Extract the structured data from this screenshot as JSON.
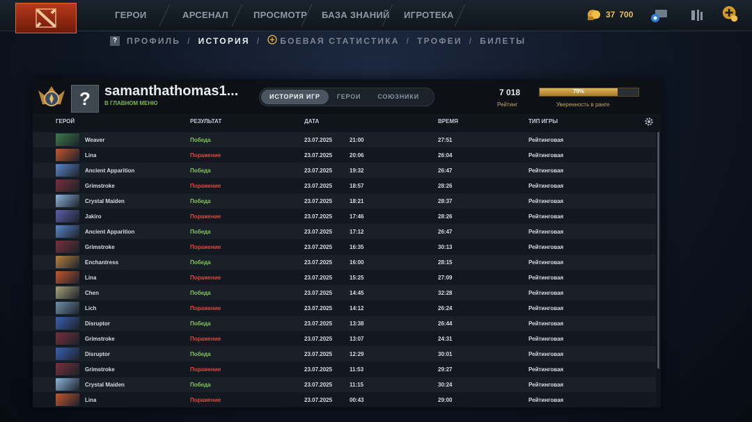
{
  "nav": {
    "items": [
      "ГЕРОИ",
      "АРСЕНАЛ",
      "ПРОСМОТР",
      "БАЗА ЗНАНИЙ",
      "ИГРОТЕКА"
    ],
    "currency_a": "37",
    "currency_b": "700"
  },
  "subnav": {
    "items": [
      "ПРОФИЛЬ",
      "ИСТОРИЯ",
      "БОЕВАЯ СТАТИСТИКА",
      "ТРОФЕИ",
      "БИЛЕТЫ"
    ],
    "active": "ИСТОРИЯ"
  },
  "profile": {
    "username": "samanthathomas1...",
    "status": "В ГЛАВНОМ МЕНЮ",
    "avatar_symbol": "?",
    "tabs": [
      "ИСТОРИЯ ИГР",
      "ГЕРОИ",
      "СОЮЗНИКИ"
    ],
    "rating_value": "7 018",
    "rating_label": "Рейтинг",
    "confidence_percent": 79,
    "confidence_text": "79%",
    "confidence_label": "Уверенность в ранге"
  },
  "table": {
    "columns": [
      "ГЕРОЙ",
      "РЕЗУЛЬТАТ",
      "ДАТА",
      "ВРЕМЯ",
      "ТИП ИГРЫ"
    ],
    "rows": [
      {
        "hero": "Weaver",
        "result": "Победа",
        "win": true,
        "date": "23.07.2025",
        "time": "21:00",
        "duration": "27:51",
        "mode": "Рейтинговая"
      },
      {
        "hero": "Lina",
        "result": "Поражение",
        "win": false,
        "date": "23.07.2025",
        "time": "20:06",
        "duration": "26:04",
        "mode": "Рейтинговая"
      },
      {
        "hero": "Ancient Apparition",
        "result": "Победа",
        "win": true,
        "date": "23.07.2025",
        "time": "19:32",
        "duration": "26:47",
        "mode": "Рейтинговая"
      },
      {
        "hero": "Grimstroke",
        "result": "Поражение",
        "win": false,
        "date": "23.07.2025",
        "time": "18:57",
        "duration": "28:26",
        "mode": "Рейтинговая"
      },
      {
        "hero": "Crystal Maiden",
        "result": "Победа",
        "win": true,
        "date": "23.07.2025",
        "time": "18:21",
        "duration": "28:37",
        "mode": "Рейтинговая"
      },
      {
        "hero": "Jakiro",
        "result": "Поражение",
        "win": false,
        "date": "23.07.2025",
        "time": "17:46",
        "duration": "28:26",
        "mode": "Рейтинговая"
      },
      {
        "hero": "Ancient Apparition",
        "result": "Победа",
        "win": true,
        "date": "23.07.2025",
        "time": "17:12",
        "duration": "26:47",
        "mode": "Рейтинговая"
      },
      {
        "hero": "Grimstroke",
        "result": "Поражение",
        "win": false,
        "date": "23.07.2025",
        "time": "16:35",
        "duration": "30:13",
        "mode": "Рейтинговая"
      },
      {
        "hero": "Enchantress",
        "result": "Победа",
        "win": true,
        "date": "23.07.2025",
        "time": "16:00",
        "duration": "28:15",
        "mode": "Рейтинговая"
      },
      {
        "hero": "Lina",
        "result": "Поражение",
        "win": false,
        "date": "23.07.2025",
        "time": "15:25",
        "duration": "27:09",
        "mode": "Рейтинговая"
      },
      {
        "hero": "Chen",
        "result": "Победа",
        "win": true,
        "date": "23.07.2025",
        "time": "14:45",
        "duration": "32:28",
        "mode": "Рейтинговая"
      },
      {
        "hero": "Lich",
        "result": "Поражение",
        "win": false,
        "date": "23.07.2025",
        "time": "14:12",
        "duration": "26:24",
        "mode": "Рейтинговая"
      },
      {
        "hero": "Disruptor",
        "result": "Победа",
        "win": true,
        "date": "23.07.2025",
        "time": "13:38",
        "duration": "26:44",
        "mode": "Рейтинговая"
      },
      {
        "hero": "Grimstroke",
        "result": "Поражение",
        "win": false,
        "date": "23.07.2025",
        "time": "13:07",
        "duration": "24:31",
        "mode": "Рейтинговая"
      },
      {
        "hero": "Disruptor",
        "result": "Победа",
        "win": true,
        "date": "23.07.2025",
        "time": "12:29",
        "duration": "30:01",
        "mode": "Рейтинговая"
      },
      {
        "hero": "Grimstroke",
        "result": "Поражение",
        "win": false,
        "date": "23.07.2025",
        "time": "11:53",
        "duration": "29:27",
        "mode": "Рейтинговая"
      },
      {
        "hero": "Crystal Maiden",
        "result": "Победа",
        "win": true,
        "date": "23.07.2025",
        "time": "11:15",
        "duration": "30:24",
        "mode": "Рейтинговая"
      },
      {
        "hero": "Lina",
        "result": "Поражение",
        "win": false,
        "date": "23.07.2025",
        "time": "00:43",
        "duration": "29:00",
        "mode": "Рейтинговая"
      }
    ]
  },
  "colors": {
    "win": "#84c45a",
    "loss": "#e0473d",
    "accent_gold": "#e0b25a",
    "hero_thumbs": {
      "Weaver": "#3f7a4a",
      "Lina": "#c4562a",
      "Ancient Apparition": "#5e86c9",
      "Grimstroke": "#7a2f3a",
      "Crystal Maiden": "#8fb3d9",
      "Jakiro": "#5a5fa8",
      "Enchantress": "#b9823e",
      "Chen": "#a8a27a",
      "Lich": "#6f8fa8",
      "Disruptor": "#3b5fb0"
    }
  },
  "icons": [
    "dota-logo-icon",
    "shards-icon",
    "chat-icon",
    "armory-icon",
    "plus-icon",
    "help-icon",
    "plus-badge-icon",
    "rank-badge-icon",
    "gear-icon"
  ]
}
